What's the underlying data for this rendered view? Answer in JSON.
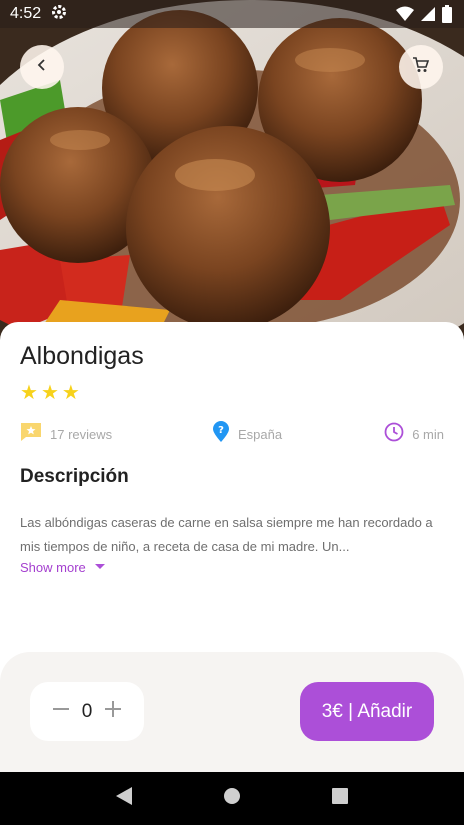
{
  "status_bar": {
    "time": "4:52",
    "icons": [
      "settings-icon",
      "wifi-icon",
      "signal-icon",
      "battery-icon"
    ]
  },
  "header": {
    "back_icon": "chevron-left-icon",
    "cart_icon": "cart-icon"
  },
  "product": {
    "name": "Albondigas",
    "rating": 3,
    "reviews": "17 reviews",
    "country": "España",
    "time": "6 min",
    "description_title": "Descripción",
    "description": "Las albóndigas caseras de carne en salsa siempre me han recordado a mis tiempos de niño, a receta de casa de mi madre. Un...",
    "show_more": "Show more"
  },
  "order": {
    "quantity": "0",
    "add_label": "3€ | Añadir"
  },
  "colors": {
    "accent": "#ac4fd8",
    "star": "#f7d21b",
    "location": "#2196f3",
    "review_icon": "#f9d66e"
  }
}
